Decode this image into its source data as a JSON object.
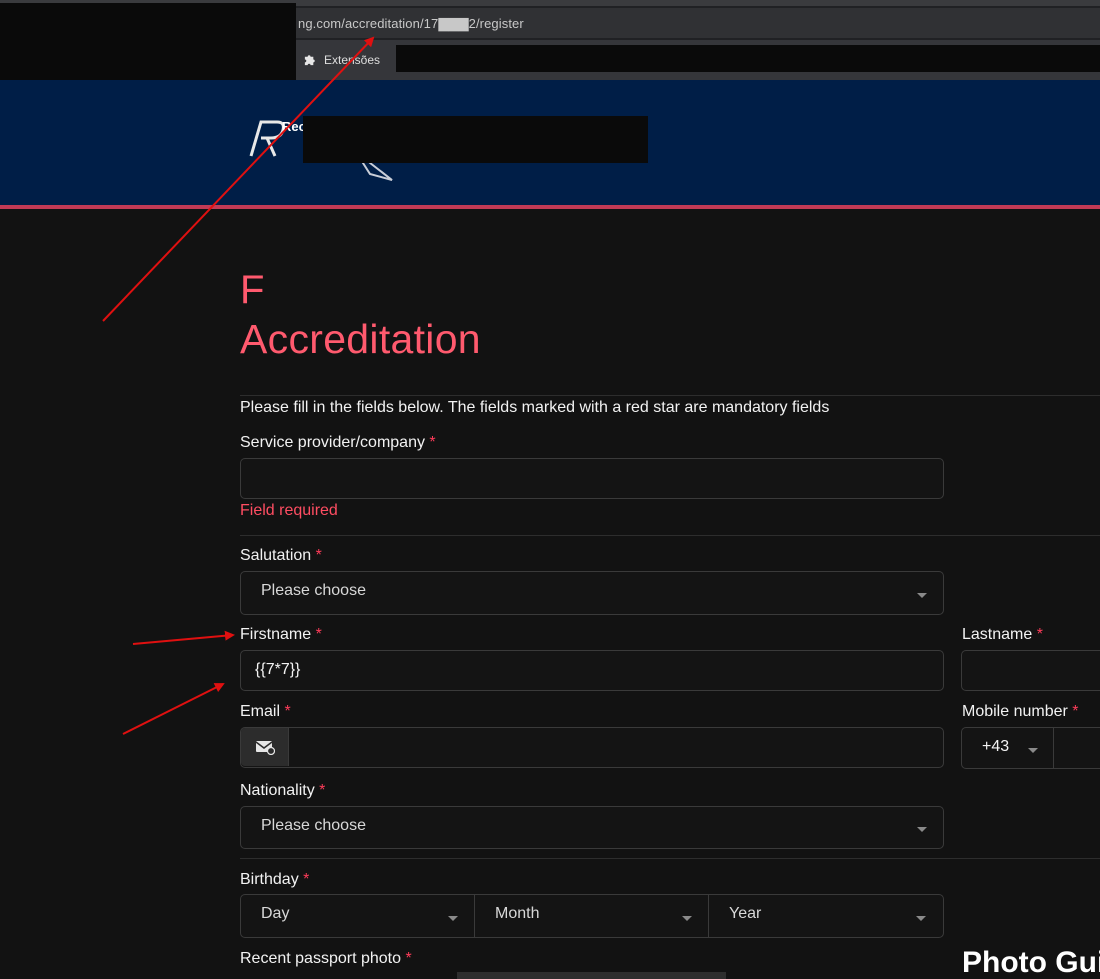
{
  "browser": {
    "url": "ng.com/accreditation/17▇▇▇2/register",
    "bookmark_label": "Extensões",
    "bookmark_icon": "puzzle-icon"
  },
  "header": {
    "logo_text": "Rec",
    "brand_color": "#001e47",
    "accent_line_color": "#c23a55"
  },
  "page": {
    "title_line1": "F",
    "title_line2": "Accreditation",
    "title_color": "#ff5a6e",
    "intro": "Please fill in the fields below. The fields marked with a red star are mandatory fields"
  },
  "form": {
    "star": "*",
    "company": {
      "label": "Service provider/company",
      "value": "",
      "error": "Field required"
    },
    "salutation": {
      "label": "Salutation",
      "placeholder": "Please choose"
    },
    "firstname": {
      "label": "Firstname",
      "value": "{{7*7}}"
    },
    "lastname": {
      "label": "Lastname",
      "value": ""
    },
    "email": {
      "label": "Email",
      "value": "",
      "icon": "envelope-icon"
    },
    "mobile": {
      "label": "Mobile number",
      "prefix": "+43",
      "value": ""
    },
    "nationality": {
      "label": "Nationality",
      "placeholder": "Please choose"
    },
    "birthday": {
      "label": "Birthday",
      "day": "Day",
      "month": "Month",
      "year": "Year"
    },
    "passport_photo": {
      "label": "Recent passport photo"
    }
  },
  "sidebar": {
    "photo_guide_title": "Photo Gui"
  },
  "annotation": {
    "arrow_color": "#e01010"
  }
}
